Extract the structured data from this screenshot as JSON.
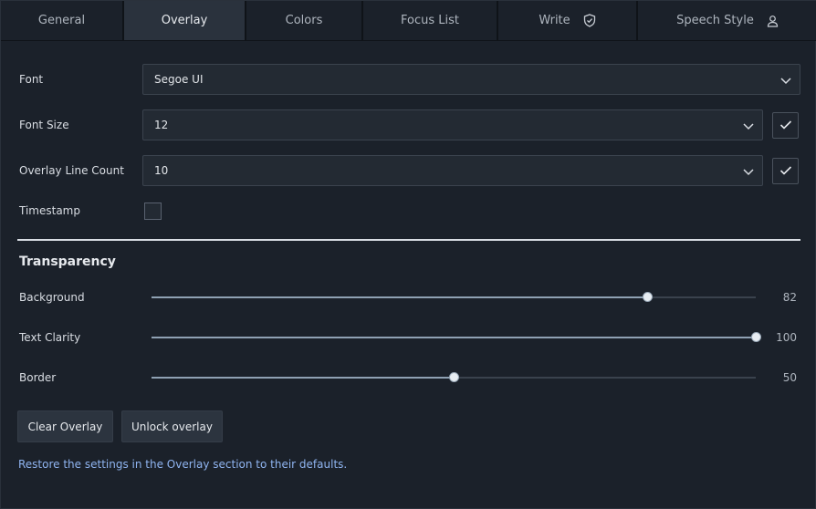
{
  "tabs": [
    {
      "label": "General",
      "icon": ""
    },
    {
      "label": "Overlay",
      "icon": "",
      "active": true
    },
    {
      "label": "Colors",
      "icon": ""
    },
    {
      "label": "Focus List",
      "icon": ""
    },
    {
      "label": "Write",
      "icon": "shield-check-icon"
    },
    {
      "label": "Speech Style",
      "icon": "person-icon"
    }
  ],
  "form": {
    "font_label": "Font",
    "font_value": "Segoe UI",
    "font_size_label": "Font Size",
    "font_size_value": "12",
    "line_count_label": "Overlay Line Count",
    "line_count_value": "10",
    "timestamp_label": "Timestamp",
    "timestamp_checked": false
  },
  "transparency": {
    "title": "Transparency",
    "sliders": [
      {
        "label": "Background",
        "value": 82,
        "value_text": "82"
      },
      {
        "label": "Text Clarity",
        "value": 100,
        "value_text": "100"
      },
      {
        "label": "Border",
        "value": 50,
        "value_text": "50"
      }
    ]
  },
  "buttons": {
    "clear_label": "Clear Overlay",
    "unlock_label": "Unlock overlay"
  },
  "restore_link": "Restore the settings in the Overlay section to their defaults.",
  "colors": {
    "background": "#1b212a",
    "accent_link": "#8fb4f0",
    "slider_fill": "#8fa1b3"
  }
}
